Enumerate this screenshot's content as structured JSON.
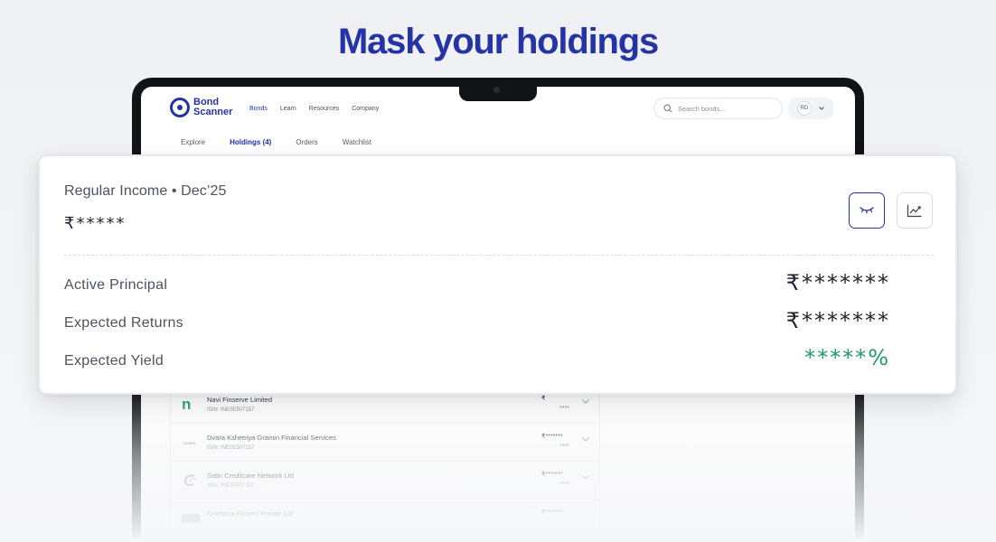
{
  "headline": "Mask your holdings",
  "site": {
    "logo_line1": "Bond",
    "logo_line2": "Scanner",
    "nav": [
      "Bonds",
      "Learn",
      "Resources",
      "Company"
    ],
    "search_placeholder": "Search bonds...",
    "user_initials": "RD",
    "tabs": [
      "Explore",
      "Holdings (4)",
      "Orders",
      "Watchlist"
    ],
    "active_tab": "Holdings (4)"
  },
  "holdings": [
    {
      "name": "Navi Finserve Limited",
      "isin": "ISIN: INE0E507157",
      "amount": "₹",
      "sub": "****",
      "logo_text": "n"
    },
    {
      "name": "Dvara Kshetriya Gramin Financial Services",
      "isin": "ISIN: INE0E507157",
      "amount": "₹*******",
      "sub": "****",
      "logo_text": "DVARA"
    },
    {
      "name": "Satin Creditcare Network Ltd",
      "isin": "ISIN: INE0E507157",
      "amount": "₹*******",
      "sub": "****",
      "logo_text": ""
    },
    {
      "name": "Keertana Finserv Private Ltd",
      "isin": "",
      "amount": "₹*******",
      "sub": "",
      "logo_text": ""
    }
  ],
  "summary": {
    "income_label": "Regular Income • Dec’25",
    "income_value": "₹*****",
    "metrics": [
      {
        "label": "Active Principal",
        "value": "₹*******"
      },
      {
        "label": "Expected Returns",
        "value": "₹*******"
      },
      {
        "label": "Expected Yield",
        "value": "*****%"
      }
    ]
  },
  "colors": {
    "brand": "#2433a6",
    "yield_green": "#1f9a66"
  },
  "icons": {
    "mask_toggle": "eye-closed-icon",
    "chart": "line-chart-icon",
    "search": "search-icon",
    "chevron": "chevron-down-icon"
  }
}
